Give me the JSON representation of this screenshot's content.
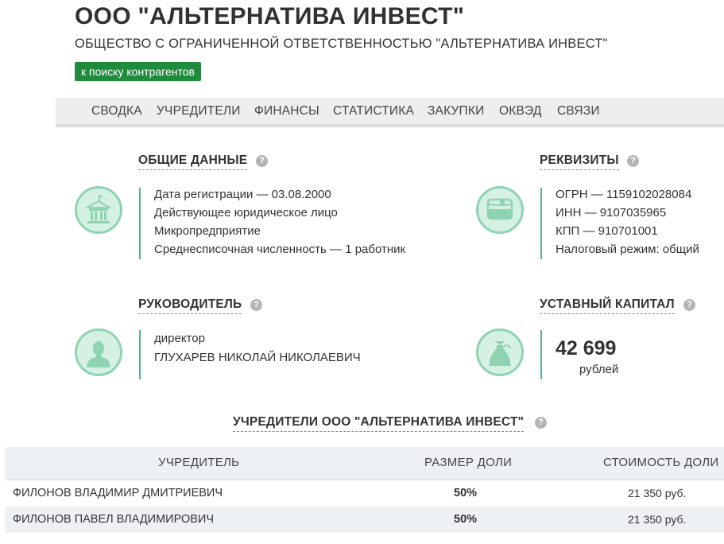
{
  "header": {
    "title": "ООО \"АЛЬТЕРНАТИВА ИНВЕСТ\"",
    "full_name": "ОБЩЕСТВО С ОГРАНИЧЕННОЙ ОТВЕТСТВЕННОСТЬЮ \"АЛЬТЕРНАТИВА ИНВЕСТ\"",
    "back_button": "к поиску контрагентов"
  },
  "nav": {
    "items": [
      "СВОДКА",
      "УЧРЕДИТЕЛИ",
      "ФИНАНСЫ",
      "СТАТИСТИКА",
      "ЗАКУПКИ",
      "ОКВЭД",
      "СВЯЗИ"
    ]
  },
  "help_glyph": "?",
  "general": {
    "title": "ОБЩИЕ ДАННЫЕ",
    "icon": "government-building-icon",
    "lines": [
      "Дата регистрации — 03.08.2000",
      "Действующее юридическое лицо",
      "Микропредприятие",
      "Среднесписочная численность — 1 работник"
    ]
  },
  "requisites": {
    "title": "РЕКВИЗИТЫ",
    "icon": "document-card-icon",
    "lines": [
      "ОГРН — 1159102028084",
      "ИНН — 9107035965",
      "КПП — 910701001",
      "Налоговый режим: общий"
    ]
  },
  "manager": {
    "title": "РУКОВОДИТЕЛЬ",
    "icon": "person-icon",
    "position": "директор",
    "name": "ГЛУХАРЕВ НИКОЛАЙ НИКОЛАЕВИЧ"
  },
  "capital": {
    "title": "УСТАВНЫЙ КАПИТАЛ",
    "icon": "money-bag-icon",
    "value": "42 699",
    "unit": "рублей"
  },
  "founders": {
    "title": "УЧРЕДИТЕЛИ ООО \"АЛЬТЕРНАТИВА ИНВЕСТ\"",
    "columns": [
      "УЧРЕДИТЕЛЬ",
      "РАЗМЕР ДОЛИ",
      "СТОИМОСТЬ ДОЛИ"
    ],
    "rows": [
      {
        "name": "ФИЛОНОВ ВЛАДИМИР ДМИТРИЕВИЧ",
        "share": "50%",
        "cost": "21 350 руб."
      },
      {
        "name": "ФИЛОНОВ ПАВЕЛ ВЛАДИМИРОВИЧ",
        "share": "50%",
        "cost": "21 350 руб."
      }
    ]
  },
  "colors": {
    "accent_green": "#1e8c3c",
    "icon_fill": "#d4f1e4",
    "icon_stroke": "#8fd3b3",
    "bar_green": "#4cb88b"
  }
}
